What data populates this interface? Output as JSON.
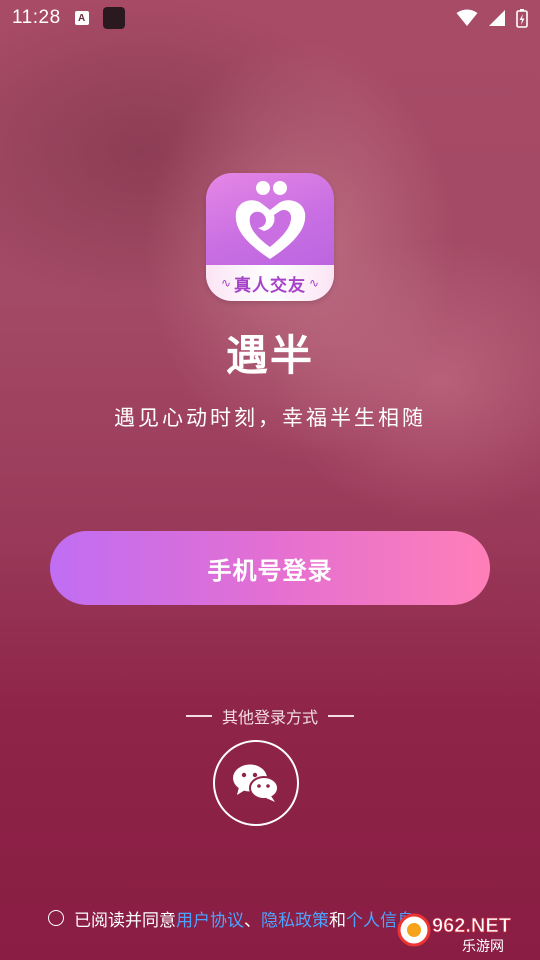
{
  "status_bar": {
    "time": "11:28"
  },
  "logo": {
    "band_text": "真人交友"
  },
  "app": {
    "name": "遇半",
    "tagline": "遇见心动时刻，幸福半生相随"
  },
  "login": {
    "phone_button_label": "手机号登录",
    "other_methods_label": "其他登录方式"
  },
  "agreement": {
    "prefix": "已阅读并同意",
    "user_agreement": "用户协议",
    "separator": "、",
    "privacy_policy": "隐私政策",
    "conjunction": "和",
    "personal_info": "个人信息"
  },
  "watermark": {
    "brand": "962.NET",
    "subtitle": "乐游网"
  },
  "colors": {
    "accent_start": "#c06ef3",
    "accent_end": "#ff7fb8",
    "link": "#4da3ff"
  }
}
